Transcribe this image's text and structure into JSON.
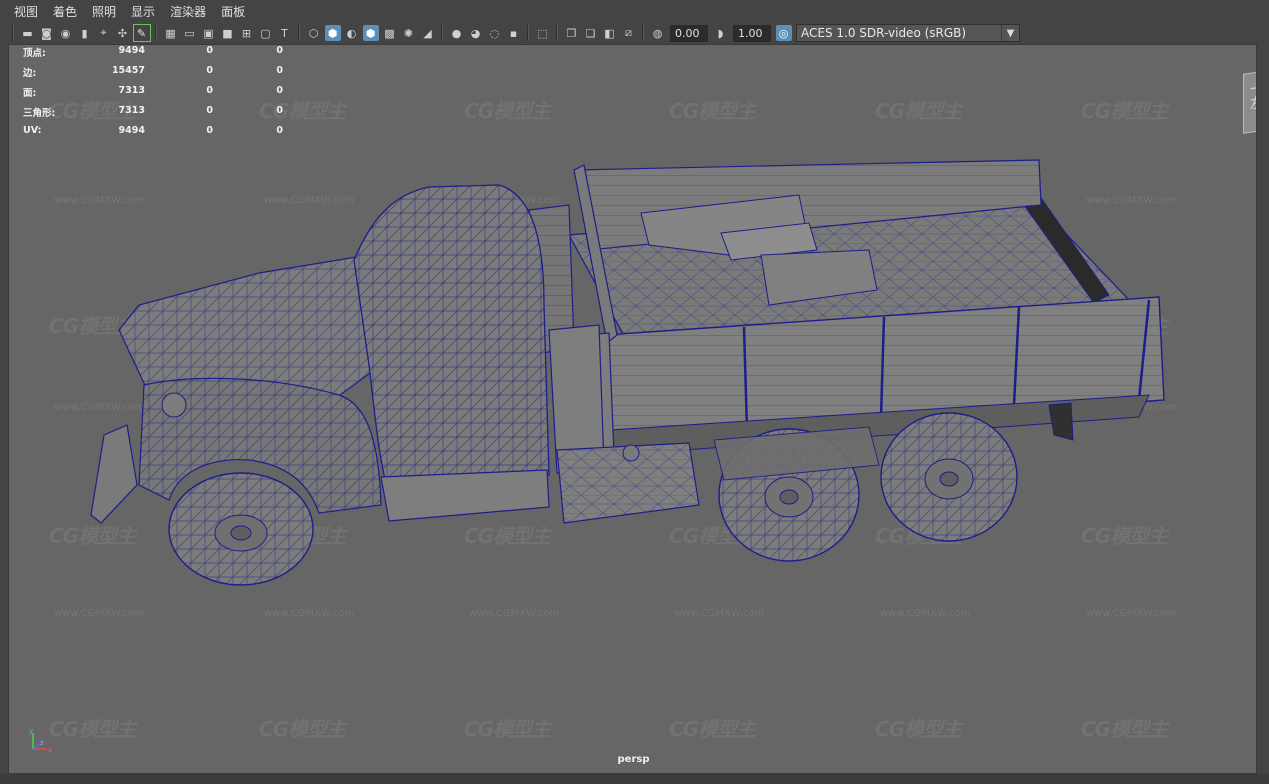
{
  "menu": {
    "items": [
      "视图",
      "着色",
      "照明",
      "显示",
      "渲染器",
      "面板"
    ]
  },
  "toolbar": {
    "exposure_value": "0.00",
    "gamma_value": "1.00",
    "color_space": "ACES 1.0 SDR-video (sRGB)",
    "icons": [
      "select-camera-icon",
      "camera-attributes-icon",
      "bookmark-icon",
      "image-plane-icon",
      "grid-icon",
      "film-gate-icon",
      "resolution-gate-icon",
      "gate-mask-icon",
      "field-chart-icon",
      "safe-action-icon",
      "safe-title-icon",
      "wireframe-icon",
      "smooth-shade-icon",
      "wireframe-on-shaded-icon",
      "textured-icon",
      "use-all-lights-icon",
      "shadows-icon",
      "screen-space-ao-icon",
      "motion-blur-icon",
      "anti-aliasing-icon",
      "depth-of-field-icon",
      "isolate-select-icon",
      "xray-icon",
      "xray-joints-icon",
      "xray-components-icon",
      "backface-culling-icon"
    ]
  },
  "hud": {
    "rows": [
      {
        "label": "顶点:",
        "values": [
          "9494",
          "0",
          "0"
        ]
      },
      {
        "label": "边:",
        "values": [
          "15457",
          "0",
          "0"
        ]
      },
      {
        "label": "面:",
        "values": [
          "7313",
          "0",
          "0"
        ]
      },
      {
        "label": "三角形:",
        "values": [
          "7313",
          "0",
          "0"
        ]
      },
      {
        "label": "UV:",
        "values": [
          "9494",
          "0",
          "0"
        ]
      }
    ]
  },
  "viewport": {
    "camera_name": "persp",
    "viewcube_text": [
      "上",
      "左"
    ],
    "axis_labels": [
      "y",
      "z",
      "x"
    ]
  },
  "watermark": {
    "logo_text": "CG模型主",
    "url_text": "www.CGMXW.com"
  },
  "colors": {
    "viewport_bg": "#666666",
    "wire": "#1c1e8a",
    "surface": "#7b7b7b",
    "ui_bg": "#444444",
    "active_blue": "#5b8fb5"
  }
}
